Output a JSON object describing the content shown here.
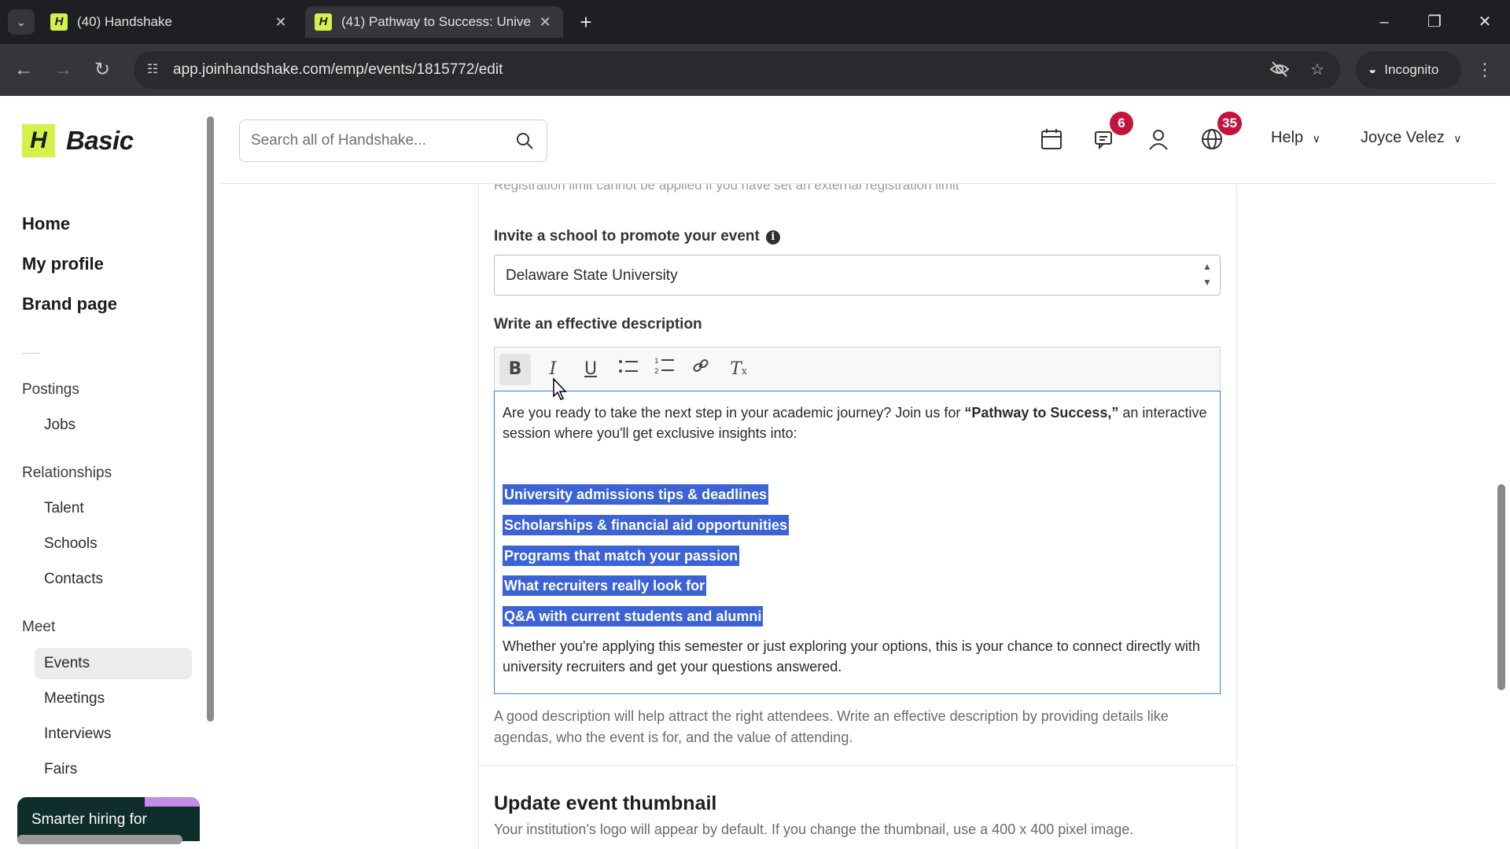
{
  "browser": {
    "tabs": [
      {
        "title": "(40) Handshake",
        "favicon": "H"
      },
      {
        "title": "(41) Pathway to Success: Unive",
        "favicon": "H"
      }
    ],
    "url": "app.joinhandshake.com/emp/events/1815772/edit",
    "incognito_label": "Incognito"
  },
  "sidebar": {
    "logo_mark": "H",
    "logo_text": "Basic",
    "main_items": [
      "Home",
      "My profile",
      "Brand page"
    ],
    "postings_heading": "Postings",
    "postings_items": [
      "Jobs"
    ],
    "relationships_heading": "Relationships",
    "relationships_items": [
      "Talent",
      "Schools",
      "Contacts"
    ],
    "meet_heading": "Meet",
    "meet_items": [
      "Events",
      "Meetings",
      "Interviews",
      "Fairs"
    ],
    "active_item": "Events",
    "promo_text": "Smarter hiring for"
  },
  "header": {
    "search_placeholder": "Search all of Handshake...",
    "messages_badge": "6",
    "notifications_badge": "35",
    "help_label": "Help",
    "user_name": "Joyce Velez"
  },
  "form": {
    "faded_note": "Registration limit cannot be applied if you have set an external registration limit",
    "invite_label": "Invite a school to promote your event",
    "invite_value": "Delaware State University",
    "description_label": "Write an effective description",
    "desc_intro_before": "Are you ready to take the next step in your academic journey? Join us for ",
    "desc_intro_bold": "“Pathway to Success,”",
    "desc_intro_after": " an interactive session where you'll get exclusive insights into:",
    "desc_list": [
      "University admissions tips & deadlines",
      "Scholarships & financial aid opportunities",
      "Programs that match your passion",
      "What recruiters really look for",
      "Q&A with current students and alumni"
    ],
    "desc_outro": "Whether you're applying this semester or just exploring your options, this is your chance to connect directly with university recruiters and get your questions answered.",
    "helper_text": "A good description will help attract the right attendees. Write an effective description by providing details like agendas, who the event is for, and the value of attending.",
    "thumbnail_title": "Update event thumbnail",
    "thumbnail_sub": "Your institution's logo will appear by default. If you change the thumbnail, use a 400 x 400 pixel image."
  },
  "colors": {
    "brand": "#d2f24a",
    "badge": "#c4133d",
    "selection": "#3b63d6",
    "editor_focus": "#2d7ff9"
  }
}
